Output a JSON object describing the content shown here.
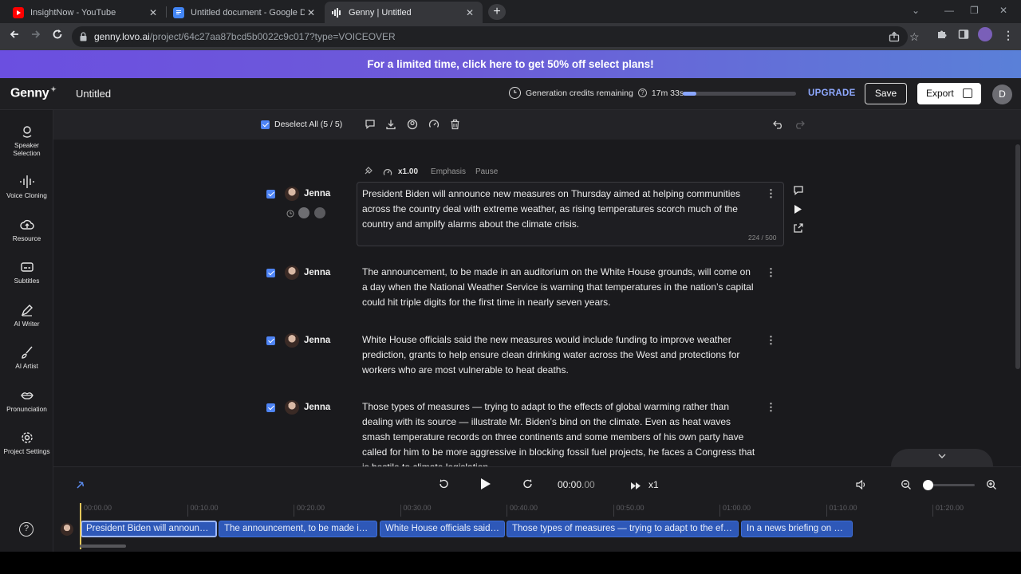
{
  "browser": {
    "tabs": [
      {
        "title": "InsightNow - YouTube",
        "favicon": "youtube-icon"
      },
      {
        "title": "Untitled document - Google Docs",
        "favicon": "docs-icon"
      },
      {
        "title": "Genny | Untitled",
        "favicon": "genny-icon"
      }
    ],
    "url_host": "genny.lovo.ai",
    "url_path": "/project/64c27aa87bcd5b0022c9c017?type=VOICEOVER",
    "profile_icon": "profile-avatar"
  },
  "promo": {
    "text": "For a limited time, click here to get 50% off select plans!"
  },
  "header": {
    "logo": "Genny",
    "project_title": "Untitled",
    "credits_label": "Generation credits remaining",
    "credits_time": "17m 33s",
    "credits_fraction": 0.12,
    "upgrade_label": "UPGRADE",
    "save_label": "Save",
    "export_label": "Export",
    "avatar_letter": "D"
  },
  "sidebar": {
    "items": [
      {
        "label": "Speaker Selection",
        "icon": "speaker-icon"
      },
      {
        "label": "Voice Cloning",
        "icon": "voice-cloning-icon"
      },
      {
        "label": "Resource",
        "icon": "upload-cloud-icon"
      },
      {
        "label": "Subtitles",
        "icon": "subtitles-icon"
      },
      {
        "label": "AI Writer",
        "icon": "pen-icon"
      },
      {
        "label": "AI Artist",
        "icon": "brush-icon"
      },
      {
        "label": "Pronunciation",
        "icon": "lips-icon"
      },
      {
        "label": "Project Settings",
        "icon": "gear-icon"
      }
    ],
    "help": "?"
  },
  "actionbar": {
    "deselect_label": "Deselect All (5 / 5)"
  },
  "block_toolbar": {
    "rate": "x1.00",
    "emphasis": "Emphasis",
    "pause": "Pause"
  },
  "blocks": [
    {
      "speaker": "Jenna",
      "text": "President Biden will announce new measures on Thursday aimed at helping communities across the country deal with extreme weather, as rising temperatures scorch much of the country and amplify alarms about the climate crisis.",
      "char_count": "224 / 500"
    },
    {
      "speaker": "Jenna",
      "text": "The announcement, to be made in an auditorium on the White House grounds, will come on a day when the National Weather Service is warning that temperatures in the nation’s capital could hit triple digits for the first time in nearly seven years."
    },
    {
      "speaker": "Jenna",
      "text": "White House officials said the new measures would include funding to improve weather prediction, grants to help ensure clean drinking water across the West and protections for workers who are most vulnerable to heat deaths."
    },
    {
      "speaker": "Jenna",
      "text": "Those types of measures — trying to adapt to the effects of global warming rather than dealing with its source — illustrate Mr. Biden’s bind on the climate. Even as heat waves smash temperature records on three continents and some members of his own party have called for him to be more aggressive in blocking fossil fuel projects, he faces a Congress that is hostile to climate legislation."
    }
  ],
  "player": {
    "time_main": "00:00",
    "time_ms": ".00",
    "speed": "x1",
    "zoom_fraction": 0.05,
    "ruler": [
      "00:00.00",
      "00:10.00",
      "00:20.00",
      "00:30.00",
      "00:40.00",
      "00:50.00",
      "01:00.00",
      "01:10.00",
      "01:20.00"
    ],
    "clips": [
      "President Biden will announce new measures on Thursday",
      "The announcement, to be made in an auditorium",
      "White House officials said the new measures",
      "Those types of measures — trying to adapt to the effects",
      "In a news briefing on Wednesday"
    ]
  }
}
